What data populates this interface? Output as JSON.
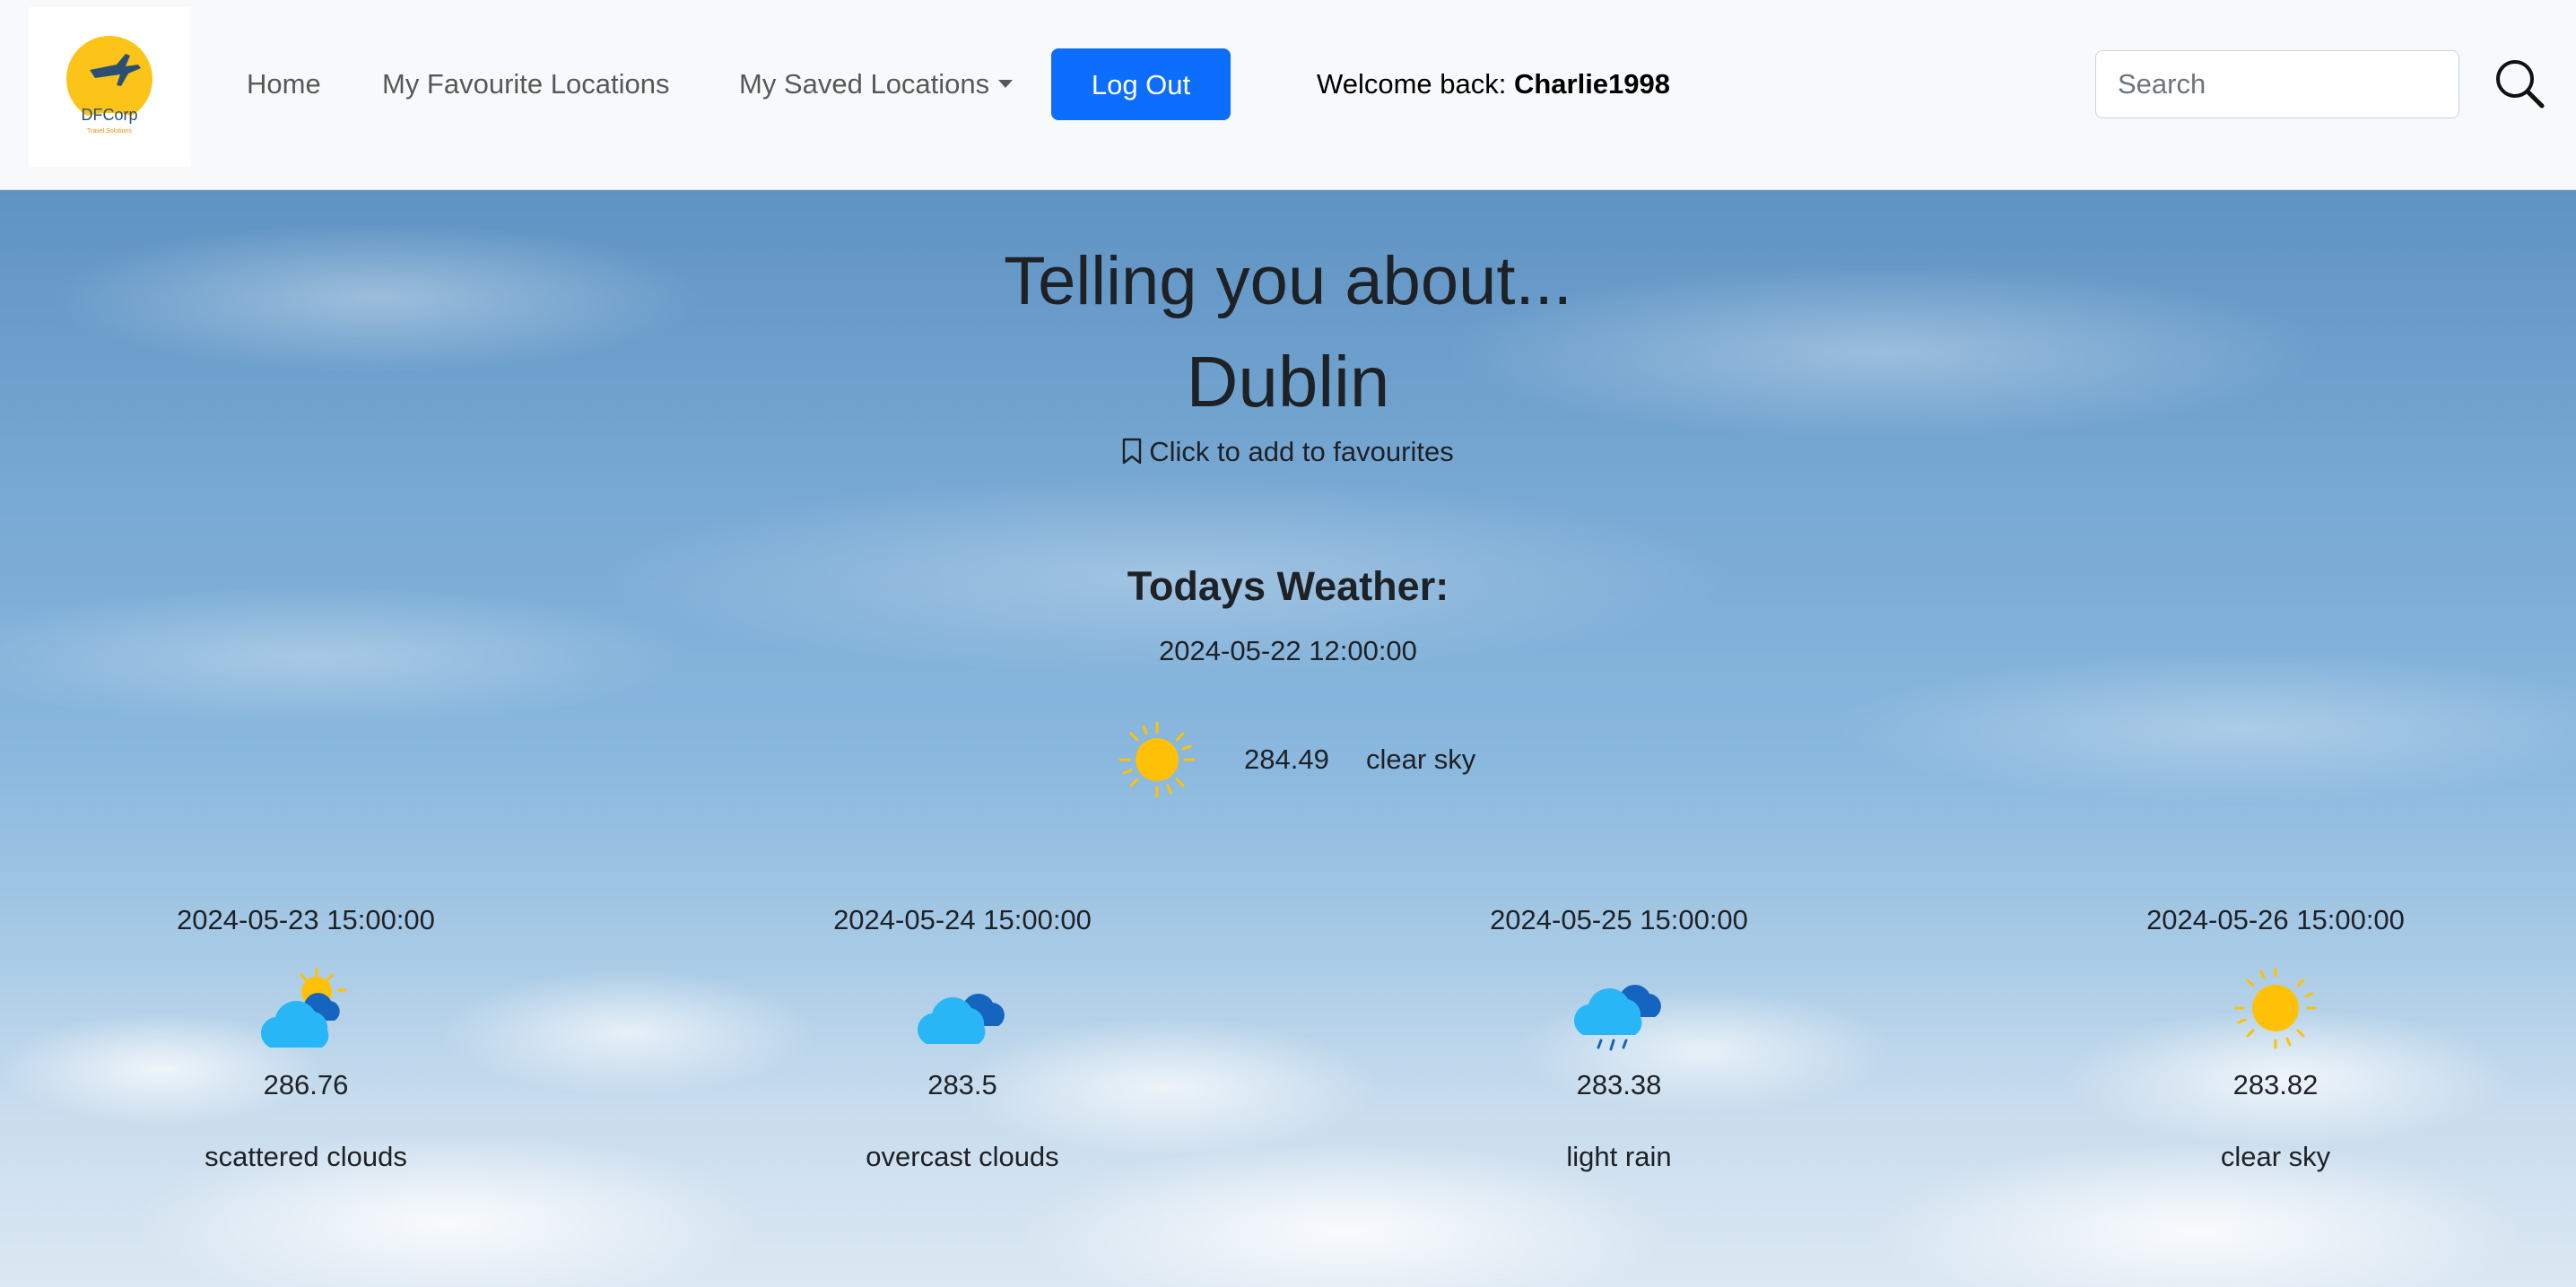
{
  "navbar": {
    "logo_text": "DFCorp",
    "logo_tagline": "Travel Solutions",
    "links": {
      "home": "Home",
      "favourites": "My Favourite Locations",
      "saved": "My Saved Locations"
    },
    "logout_label": "Log Out",
    "welcome_prefix": "Welcome back: ",
    "username": "Charlie1998",
    "search_placeholder": "Search"
  },
  "hero": {
    "heading": "Telling you about...",
    "city": "Dublin",
    "favourite_link": "Click to add to favourites"
  },
  "today": {
    "heading": "Todays Weather:",
    "datetime": "2024-05-22 12:00:00",
    "icon": "sun-icon",
    "temperature": "284.49",
    "description": "clear sky"
  },
  "forecast": [
    {
      "datetime": "2024-05-23 15:00:00",
      "icon": "partly-cloudy-icon",
      "temperature": "286.76",
      "description": "scattered clouds"
    },
    {
      "datetime": "2024-05-24 15:00:00",
      "icon": "overcast-cloud-icon",
      "temperature": "283.5",
      "description": "overcast clouds"
    },
    {
      "datetime": "2024-05-25 15:00:00",
      "icon": "rain-cloud-icon",
      "temperature": "283.38",
      "description": "light rain"
    },
    {
      "datetime": "2024-05-26 15:00:00",
      "icon": "sun-icon",
      "temperature": "283.82",
      "description": "clear sky"
    }
  ],
  "colors": {
    "primary_button": "#0d6efd",
    "navbar_bg": "#f8f9fa",
    "sun_yellow": "#ffc107",
    "cloud_blue": "#29b6f6",
    "cloud_dark_blue": "#1565c0"
  }
}
